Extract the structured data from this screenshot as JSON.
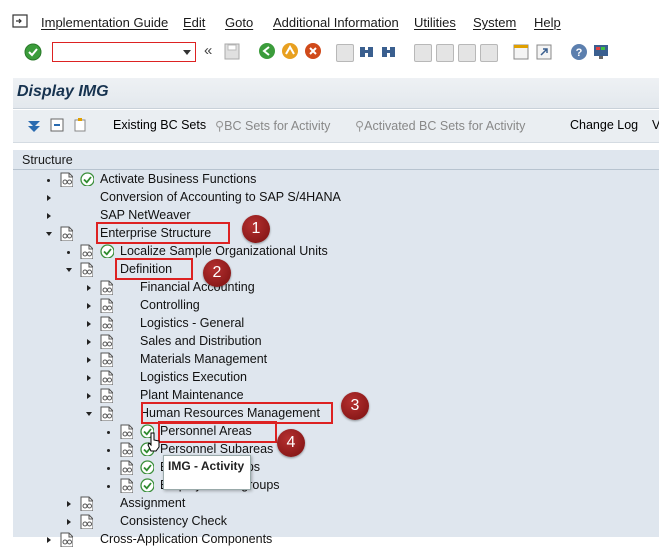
{
  "menu": {
    "items": [
      "Implementation Guide",
      "Edit",
      "Goto",
      "Additional Information",
      "Utilities",
      "System",
      "Help"
    ]
  },
  "toolbar": {
    "command_field_value": "",
    "icons": [
      "enter-icon",
      "save-icon",
      "back-icon",
      "exit-icon",
      "cancel-icon",
      "print-icon",
      "find-icon",
      "find-next-icon",
      "first-page-icon",
      "prev-page-icon",
      "next-page-icon",
      "last-page-icon",
      "create-session-icon",
      "shortcut-icon",
      "help-icon",
      "customize-layout-icon"
    ]
  },
  "title": "Display IMG",
  "app_toolbar": {
    "existing_bc_sets": "Existing BC Sets",
    "bc_sets_for_activity": "BC Sets for Activity",
    "activated_bc_sets": "Activated BC Sets for Activity",
    "change_log": "Change Log",
    "overflow": "V"
  },
  "tree": {
    "header": "Structure",
    "nodes": [
      {
        "label": "Activate Business Functions",
        "level": 0,
        "toggle": "dot",
        "doc": true,
        "check": true
      },
      {
        "label": "Conversion of Accounting to SAP S/4HANA",
        "level": 0,
        "toggle": "right",
        "doc": false,
        "check": false
      },
      {
        "label": "SAP NetWeaver",
        "level": 0,
        "toggle": "right",
        "doc": false,
        "check": false
      },
      {
        "label": "Enterprise Structure",
        "level": 0,
        "toggle": "down",
        "doc": true,
        "check": false
      },
      {
        "label": "Localize Sample Organizational Units",
        "level": 1,
        "toggle": "dot",
        "doc": true,
        "check": true
      },
      {
        "label": "Definition",
        "level": 1,
        "toggle": "down",
        "doc": true,
        "check": false
      },
      {
        "label": "Financial Accounting",
        "level": 2,
        "toggle": "right",
        "doc": true,
        "check": false
      },
      {
        "label": "Controlling",
        "level": 2,
        "toggle": "right",
        "doc": true,
        "check": false
      },
      {
        "label": "Logistics - General",
        "level": 2,
        "toggle": "right",
        "doc": true,
        "check": false
      },
      {
        "label": "Sales and Distribution",
        "level": 2,
        "toggle": "right",
        "doc": true,
        "check": false
      },
      {
        "label": "Materials Management",
        "level": 2,
        "toggle": "right",
        "doc": true,
        "check": false
      },
      {
        "label": "Logistics Execution",
        "level": 2,
        "toggle": "right",
        "doc": true,
        "check": false
      },
      {
        "label": "Plant Maintenance",
        "level": 2,
        "toggle": "right",
        "doc": true,
        "check": false
      },
      {
        "label": "Human Resources Management",
        "level": 2,
        "toggle": "down",
        "doc": true,
        "check": false
      },
      {
        "label": "Personnel Areas",
        "level": 3,
        "toggle": "dot",
        "doc": true,
        "check": true
      },
      {
        "label": "Personnel Subareas",
        "level": 3,
        "toggle": "dot",
        "doc": true,
        "check": true
      },
      {
        "label": "Employee Groups",
        "level": 3,
        "toggle": "dot",
        "doc": true,
        "check": true
      },
      {
        "label": "Employee Subgroups",
        "level": 3,
        "toggle": "dot",
        "doc": true,
        "check": true
      },
      {
        "label": "Assignment",
        "level": 1,
        "toggle": "right",
        "doc": true,
        "check": false
      },
      {
        "label": "Consistency Check",
        "level": 1,
        "toggle": "right",
        "doc": true,
        "check": false
      },
      {
        "label": "Cross-Application Components",
        "level": 0,
        "toggle": "right",
        "doc": true,
        "check": false
      }
    ]
  },
  "annotations": {
    "badges": [
      "1",
      "2",
      "3",
      "4"
    ]
  },
  "tooltip": "IMG - Activity",
  "colors": {
    "tree_bg": "#dfe6ee",
    "annotation_red": "#d22222",
    "badge_red": "#8f1a1a",
    "title_color": "#16324f"
  }
}
